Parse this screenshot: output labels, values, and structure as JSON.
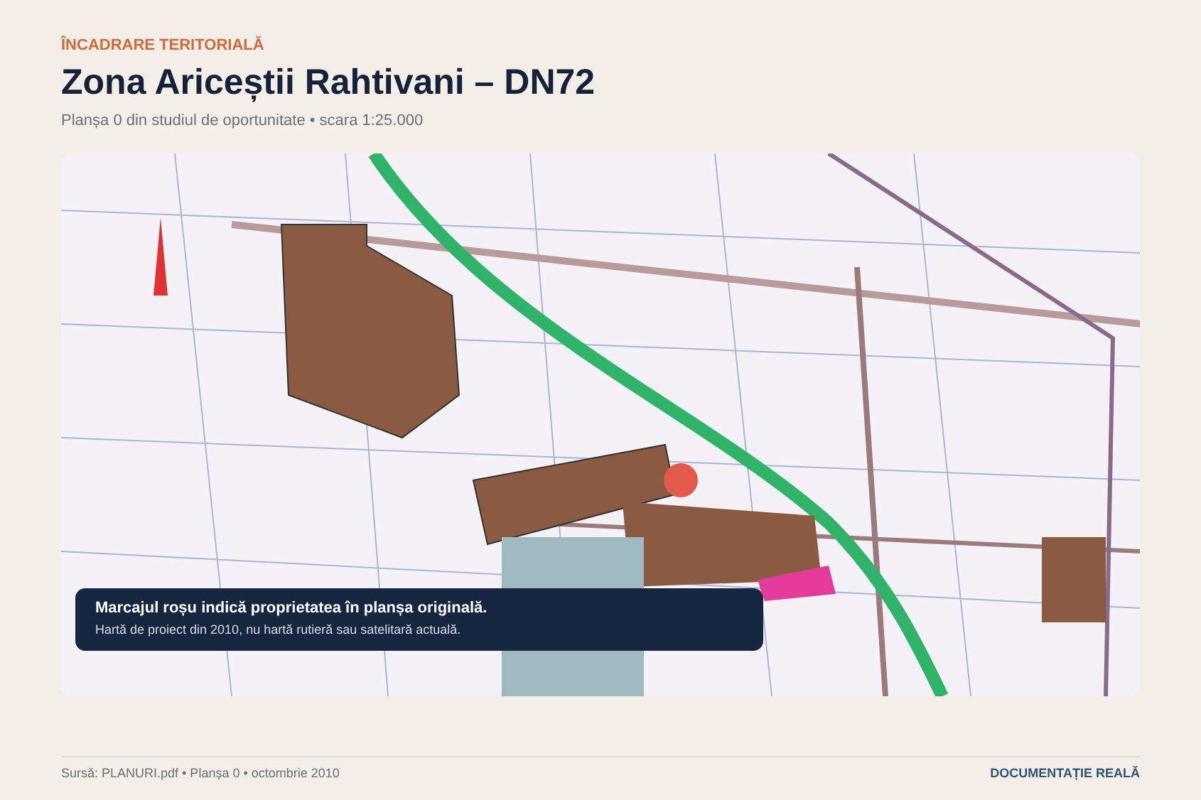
{
  "header": {
    "eyebrow": "ÎNCADRARE TERITORIALĂ",
    "title": "Zona Ariceștii Rahtivani – DN72",
    "subtitle": "Planșa 0 din studiul de oportunitate • scara 1:25.000"
  },
  "map": {
    "caption": {
      "title": "Marcajul roșu indică proprietatea în planșa originală.",
      "note": "Hartă de proiect din 2010, nu hartă rutieră sau satelitară actuală."
    }
  },
  "footer": {
    "source": "Sursă: PLANURI.pdf • Planșa 0 • octombrie 2010",
    "badge": "DOCUMENTAȚIE REALĂ"
  }
}
